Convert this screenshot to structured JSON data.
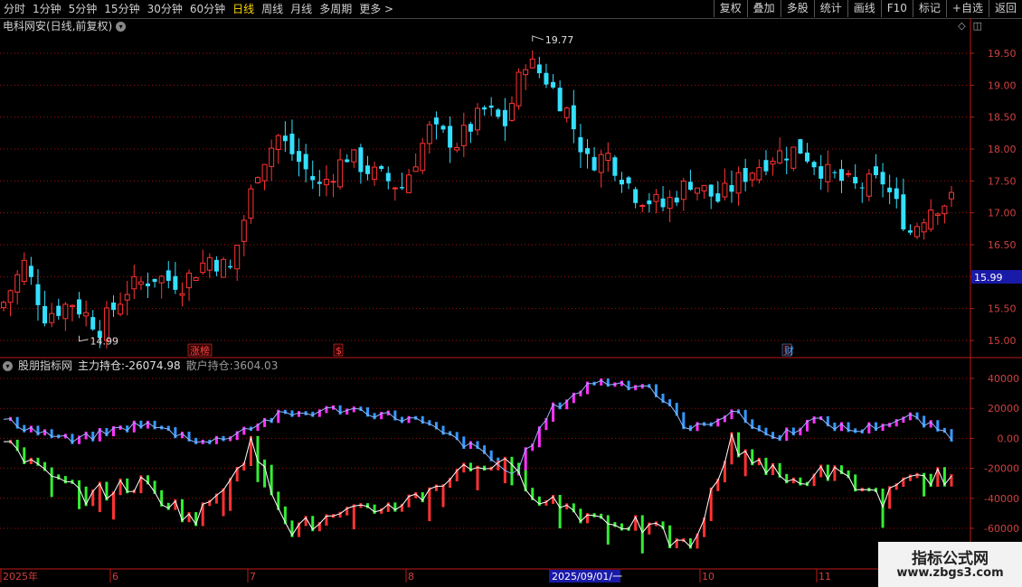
{
  "toolbar": {
    "periods": [
      "分时",
      "1分钟",
      "5分钟",
      "15分钟",
      "30分钟",
      "60分钟",
      "日线",
      "周线",
      "月线",
      "多周期",
      "更多 >"
    ],
    "active_period": "日线",
    "right_buttons": [
      "复权",
      "叠加",
      "多股",
      "统计",
      "画线",
      "F10",
      "标记",
      "+自选",
      "返回"
    ]
  },
  "stock": {
    "title": "电科网安(日线,前复权)"
  },
  "price_axis": {
    "ticks": [
      "19.50",
      "19.00",
      "18.50",
      "18.00",
      "17.50",
      "17.00",
      "16.50",
      "16.00",
      "15.50",
      "15.00"
    ],
    "current_price": "15.99"
  },
  "annotations": {
    "high": "19.77",
    "low": "14.99",
    "events": [
      "涨榜",
      "$",
      "财"
    ]
  },
  "indicator": {
    "name": "股朋指标网",
    "main_label": "主力持仓:",
    "main_value": "-26074.98",
    "retail_label": "散户持仓:",
    "retail_value": "3604.03",
    "ticks": [
      "40000",
      "20000",
      "0.00",
      "-20000",
      "-40000",
      "-60000"
    ]
  },
  "time_axis": {
    "labels": [
      "2025年",
      "6",
      "7",
      "8",
      "2025/09/01/一",
      "10",
      "11"
    ]
  },
  "watermark": {
    "line1": "指标公式网",
    "line2": "www.zbgs3.com"
  },
  "colors": {
    "up": "#ff3333",
    "down": "#33e0ff",
    "magenta": "#ff33ff",
    "blue": "#3399ff",
    "green": "#33ee33",
    "grid": "#a01010"
  },
  "chart_data": {
    "type": "candlestick",
    "price_range": [
      14.9,
      19.85
    ],
    "indicator_range": [
      -70000,
      48000
    ],
    "candles": []
  }
}
